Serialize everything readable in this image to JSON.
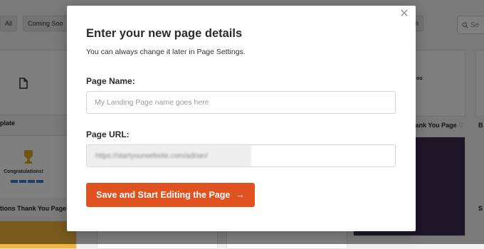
{
  "background": {
    "filters": {
      "all": "All",
      "coming_soon": "Coming Soo",
      "partial_right": "in"
    },
    "search_placeholder": "Se",
    "cards": {
      "blank_label": "plate",
      "thank_label_left": "tions Thank You Page",
      "trophy_text": "Congratulations!",
      "thank_label_right": "hank You Page",
      "partial_right_label": "B",
      "partial_right_bottom": "S",
      "right_top_text": "ou"
    }
  },
  "modal": {
    "close_icon": "✕",
    "title": "Enter your new page details",
    "subtitle": "You can always change it later in Page Settings.",
    "page_name_label": "Page Name:",
    "page_name_placeholder": "My Landing Page name goes here",
    "page_url_label": "Page URL:",
    "page_url_value": "https://startyourwebsite.com/adrian/",
    "submit_label": "Save and Start Editing the Page",
    "submit_arrow": "→"
  },
  "colors": {
    "accent": "#e0521f",
    "overlay": "rgba(0,0,0,0.5)"
  }
}
